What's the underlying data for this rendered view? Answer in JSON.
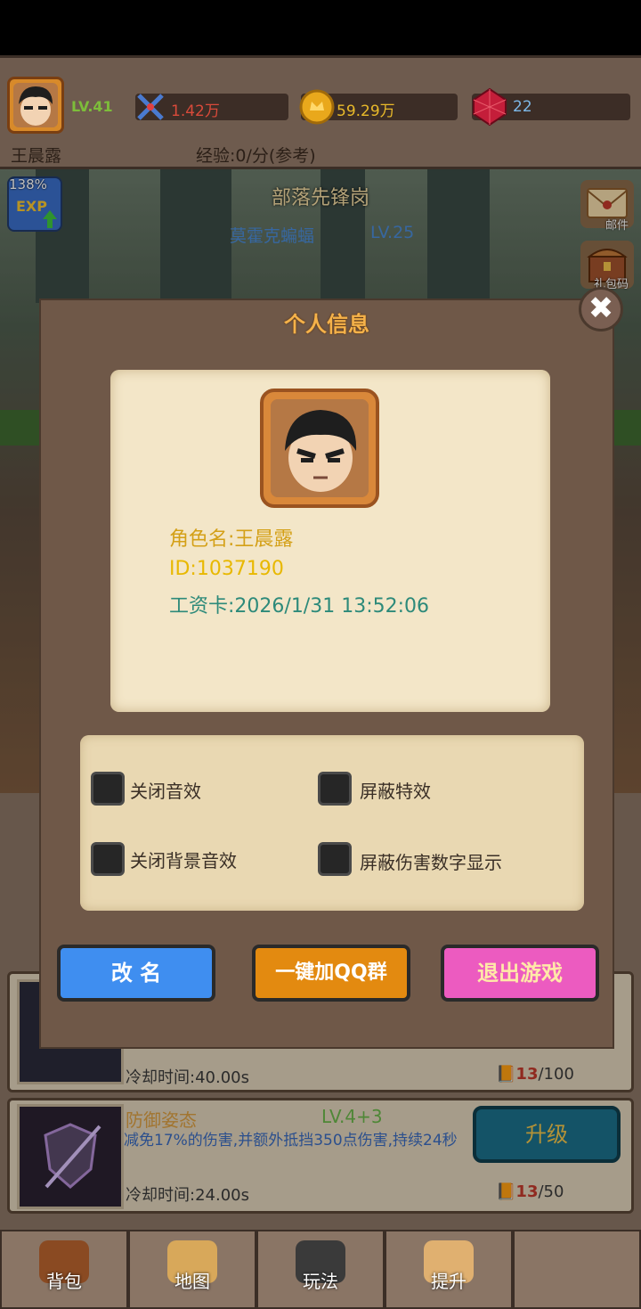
{
  "top_bar": {
    "level": "LV.41",
    "combat_power": "1.42万",
    "gold": "59.29万",
    "gems": "22",
    "player_name": "王晨露",
    "exp_rate": "经验:0/分(参考)"
  },
  "scene": {
    "exp_bonus": "138%",
    "exp_badge": "EXP",
    "stage_name": "部落先锋岗",
    "monster_name": "莫霍克蝙蝠",
    "monster_level": "LV.25"
  },
  "side_menu": [
    {
      "label": "邮件",
      "icon": "mail-icon"
    },
    {
      "label": "礼包码",
      "icon": "gift-chest-icon"
    }
  ],
  "dialog": {
    "title": "个人信息",
    "role_name": "角色名:王晨露",
    "player_id": "ID:1037190",
    "salary_card": "工资卡:2026/1/31 13:52:06",
    "settings": [
      {
        "label": "关闭音效",
        "checked": false
      },
      {
        "label": "屏蔽特效",
        "checked": false
      },
      {
        "label": "关闭背景音效",
        "checked": false
      },
      {
        "label": "屏蔽伤害数字显示",
        "checked": false
      }
    ],
    "buttons": {
      "rename": "改 名",
      "join_qq": "一键加QQ群",
      "quit": "退出游戏"
    },
    "close_symbol": "✖"
  },
  "skills": [
    {
      "cooldown": "冷却时间:40.00s",
      "cost_current": "13",
      "cost_total": "/100"
    },
    {
      "name": "防御姿态",
      "level": "LV.4+3",
      "description": "减免17%的伤害,并额外抵挡350点伤害,持续24秒",
      "cooldown": "冷却时间:24.00s",
      "cost_current": "13",
      "cost_total": "/50",
      "button": "升级"
    }
  ],
  "bottom_nav": [
    {
      "label": "背包",
      "icon": "backpack-icon"
    },
    {
      "label": "地图",
      "icon": "map-scroll-icon"
    },
    {
      "label": "玩法",
      "icon": "gamepad-icon"
    },
    {
      "label": "提升",
      "icon": "fist-icon"
    },
    {
      "label": "",
      "icon": "empty-slot"
    }
  ],
  "colors": {
    "accent_gold": "#f5b24a",
    "role_name": "#d4a017",
    "player_id": "#e8b800",
    "salary_card": "#2d8a7a",
    "rename_button": "#3f8ef0",
    "qq_button": "#e38a10",
    "quit_button": "#ec5bc0"
  }
}
